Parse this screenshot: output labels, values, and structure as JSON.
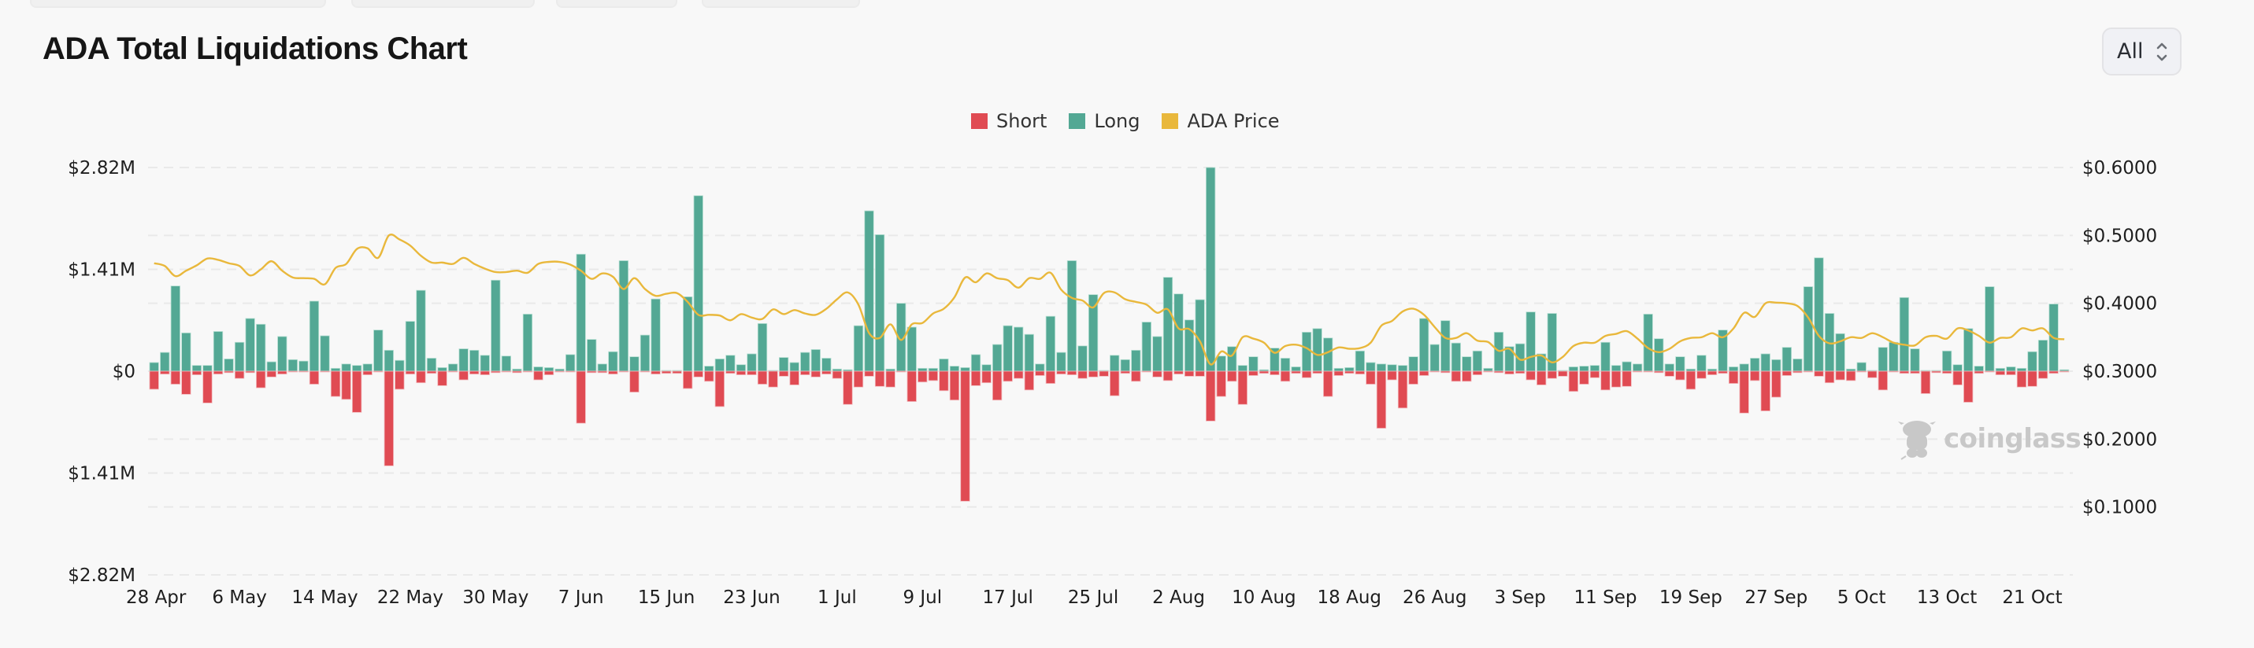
{
  "header": {
    "title": "ADA Total Liquidations Chart",
    "range_select": {
      "value": "All",
      "icon": "chevron-up-down-icon"
    }
  },
  "legend": [
    {
      "label": "Short",
      "color": "#e04b53"
    },
    {
      "label": "Long",
      "color": "#53a894"
    },
    {
      "label": "ADA Price",
      "color": "#e9b83c"
    }
  ],
  "watermark": {
    "text": "coinglass",
    "icon": "coinglass-mascot-icon"
  },
  "chart_data": {
    "type": "bar",
    "title": "ADA Total Liquidations Chart",
    "xlabel": "",
    "ylabel": "",
    "y_left": {
      "ticks": [
        "$2.82M",
        "$1.41M",
        "$0",
        "$1.41M",
        "$2.82M"
      ],
      "range": [
        -2820000,
        2820000
      ]
    },
    "y_right": {
      "ticks": [
        "$0.6000",
        "$0.5000",
        "$0.4000",
        "$0.3000",
        "$0.2000",
        "$0.1000"
      ],
      "range": [
        0,
        0.6
      ]
    },
    "x_tick_labels": [
      "28 Apr",
      "6 May",
      "14 May",
      "22 May",
      "30 May",
      "7 Jun",
      "15 Jun",
      "23 Jun",
      "1 Jul",
      "9 Jul",
      "17 Jul",
      "25 Jul",
      "2 Aug",
      "10 Aug",
      "18 Aug",
      "26 Aug",
      "3 Sep",
      "11 Sep",
      "19 Sep",
      "27 Sep",
      "5 Oct",
      "13 Oct",
      "21 Oct"
    ],
    "x_tick_every": 8,
    "start_date": "28 Apr",
    "grid": true,
    "legend_position": "top-center",
    "series": [
      {
        "name": "Long",
        "type": "bar",
        "axis": "left",
        "unit": "USD millions",
        "color": "#53a894",
        "values": [
          0.12,
          0.26,
          1.18,
          0.53,
          0.08,
          0.08,
          0.55,
          0.17,
          0.4,
          0.73,
          0.65,
          0.13,
          0.48,
          0.16,
          0.14,
          0.97,
          0.49,
          0.04,
          0.1,
          0.08,
          0.1,
          0.57,
          0.29,
          0.15,
          0.69,
          1.12,
          0.18,
          0.05,
          0.1,
          0.31,
          0.29,
          0.22,
          1.26,
          0.21,
          0.03,
          0.79,
          0.06,
          0.05,
          0.03,
          0.23,
          1.62,
          0.44,
          0.1,
          0.27,
          1.53,
          0.2,
          0.5,
          1.0,
          0.01,
          0.01,
          1.03,
          2.43,
          0.07,
          0.17,
          0.22,
          0.09,
          0.24,
          0.66,
          0.01,
          0.19,
          0.12,
          0.26,
          0.3,
          0.18,
          0.03,
          0.02,
          0.63,
          2.22,
          1.89,
          0.03,
          0.94,
          0.61,
          0.04,
          0.04,
          0.17,
          0.07,
          0.05,
          0.23,
          0.09,
          0.37,
          0.63,
          0.61,
          0.51,
          0.1,
          0.76,
          0.26,
          1.53,
          0.35,
          1.06,
          0.01,
          0.22,
          0.16,
          0.29,
          0.68,
          0.48,
          1.3,
          1.07,
          0.71,
          0.99,
          2.82,
          0.21,
          0.34,
          0.08,
          0.2,
          0.02,
          0.32,
          0.18,
          0.06,
          0.54,
          0.59,
          0.46,
          0.04,
          0.05,
          0.28,
          0.12,
          0.1,
          0.09,
          0.08,
          0.2,
          0.73,
          0.37,
          0.7,
          0.39,
          0.2,
          0.28,
          0.04,
          0.54,
          0.34,
          0.38,
          0.82,
          0.24,
          0.8,
          0.01,
          0.06,
          0.07,
          0.08,
          0.4,
          0.08,
          0.13,
          0.1,
          0.79,
          0.45,
          0.1,
          0.2,
          0.03,
          0.22,
          0.03,
          0.57,
          0.06,
          0.1,
          0.18,
          0.24,
          0.16,
          0.33,
          0.17,
          1.17,
          1.57,
          0.8,
          0.52,
          0.03,
          0.12,
          0.01,
          0.33,
          0.4,
          1.02,
          0.31,
          0.0,
          0.0,
          0.28,
          0.09,
          0.59,
          0.07,
          1.17,
          0.04,
          0.06,
          0.04,
          0.27,
          0.43,
          0.93,
          0.02
        ]
      },
      {
        "name": "Short",
        "type": "bar",
        "axis": "left",
        "unit": "USD millions",
        "color": "#e04b53",
        "values": [
          0.25,
          0.04,
          0.18,
          0.32,
          0.05,
          0.44,
          0.04,
          0.02,
          0.1,
          0.02,
          0.23,
          0.08,
          0.04,
          0.01,
          0.01,
          0.18,
          0.01,
          0.35,
          0.39,
          0.57,
          0.05,
          0.0,
          1.31,
          0.25,
          0.04,
          0.16,
          0.03,
          0.2,
          0.01,
          0.12,
          0.04,
          0.05,
          0.02,
          0.01,
          0.02,
          0.0,
          0.12,
          0.05,
          0.01,
          0.01,
          0.72,
          0.02,
          0.02,
          0.04,
          0.01,
          0.29,
          0.01,
          0.04,
          0.03,
          0.03,
          0.24,
          0.08,
          0.14,
          0.49,
          0.03,
          0.05,
          0.05,
          0.18,
          0.22,
          0.07,
          0.19,
          0.05,
          0.08,
          0.04,
          0.1,
          0.46,
          0.22,
          0.07,
          0.21,
          0.22,
          0.01,
          0.42,
          0.15,
          0.13,
          0.27,
          0.4,
          1.8,
          0.2,
          0.16,
          0.4,
          0.14,
          0.1,
          0.26,
          0.06,
          0.17,
          0.04,
          0.05,
          0.1,
          0.08,
          0.07,
          0.34,
          0.03,
          0.14,
          0.01,
          0.08,
          0.13,
          0.04,
          0.07,
          0.07,
          0.69,
          0.35,
          0.14,
          0.46,
          0.06,
          0.03,
          0.05,
          0.14,
          0.03,
          0.09,
          0.03,
          0.35,
          0.06,
          0.03,
          0.04,
          0.18,
          0.79,
          0.12,
          0.51,
          0.18,
          0.06,
          0.01,
          0.02,
          0.14,
          0.14,
          0.05,
          0.01,
          0.02,
          0.04,
          0.03,
          0.12,
          0.19,
          0.1,
          0.07,
          0.28,
          0.18,
          0.09,
          0.26,
          0.22,
          0.21,
          0.01,
          0.01,
          0.02,
          0.07,
          0.12,
          0.25,
          0.1,
          0.05,
          0.03,
          0.17,
          0.58,
          0.13,
          0.55,
          0.36,
          0.06,
          0.02,
          0.01,
          0.07,
          0.16,
          0.12,
          0.13,
          0.01,
          0.09,
          0.26,
          0.01,
          0.03,
          0.03,
          0.31,
          0.02,
          0.03,
          0.19,
          0.43,
          0.03,
          0.01,
          0.05,
          0.05,
          0.22,
          0.21,
          0.1,
          0.03,
          0.01
        ]
      },
      {
        "name": "ADA Price",
        "type": "line",
        "axis": "right",
        "unit": "USD",
        "color": "#e9b83c",
        "values": [
          0.459,
          0.455,
          0.44,
          0.448,
          0.456,
          0.466,
          0.464,
          0.459,
          0.455,
          0.441,
          0.45,
          0.462,
          0.448,
          0.438,
          0.437,
          0.436,
          0.428,
          0.452,
          0.458,
          0.48,
          0.481,
          0.467,
          0.5,
          0.494,
          0.485,
          0.47,
          0.46,
          0.46,
          0.458,
          0.467,
          0.458,
          0.451,
          0.446,
          0.446,
          0.448,
          0.445,
          0.458,
          0.461,
          0.461,
          0.457,
          0.448,
          0.436,
          0.444,
          0.439,
          0.421,
          0.437,
          0.421,
          0.411,
          0.414,
          0.415,
          0.402,
          0.383,
          0.383,
          0.382,
          0.375,
          0.384,
          0.379,
          0.377,
          0.391,
          0.384,
          0.39,
          0.385,
          0.383,
          0.392,
          0.406,
          0.416,
          0.398,
          0.356,
          0.349,
          0.369,
          0.346,
          0.369,
          0.371,
          0.385,
          0.392,
          0.409,
          0.438,
          0.431,
          0.444,
          0.437,
          0.434,
          0.423,
          0.437,
          0.436,
          0.445,
          0.42,
          0.408,
          0.404,
          0.394,
          0.415,
          0.416,
          0.406,
          0.402,
          0.398,
          0.386,
          0.391,
          0.363,
          0.362,
          0.344,
          0.31,
          0.329,
          0.323,
          0.35,
          0.348,
          0.342,
          0.327,
          0.337,
          0.339,
          0.334,
          0.324,
          0.328,
          0.335,
          0.333,
          0.334,
          0.342,
          0.367,
          0.374,
          0.388,
          0.392,
          0.383,
          0.365,
          0.349,
          0.349,
          0.356,
          0.345,
          0.343,
          0.33,
          0.333,
          0.317,
          0.321,
          0.323,
          0.313,
          0.321,
          0.337,
          0.342,
          0.342,
          0.352,
          0.355,
          0.359,
          0.348,
          0.334,
          0.328,
          0.333,
          0.344,
          0.349,
          0.35,
          0.356,
          0.35,
          0.363,
          0.386,
          0.38,
          0.4,
          0.401,
          0.4,
          0.396,
          0.379,
          0.352,
          0.341,
          0.344,
          0.35,
          0.349,
          0.356,
          0.35,
          0.342,
          0.339,
          0.338,
          0.35,
          0.352,
          0.348,
          0.363,
          0.36,
          0.352,
          0.342,
          0.349,
          0.35,
          0.363,
          0.36,
          0.363,
          0.349,
          0.347
        ]
      }
    ]
  }
}
